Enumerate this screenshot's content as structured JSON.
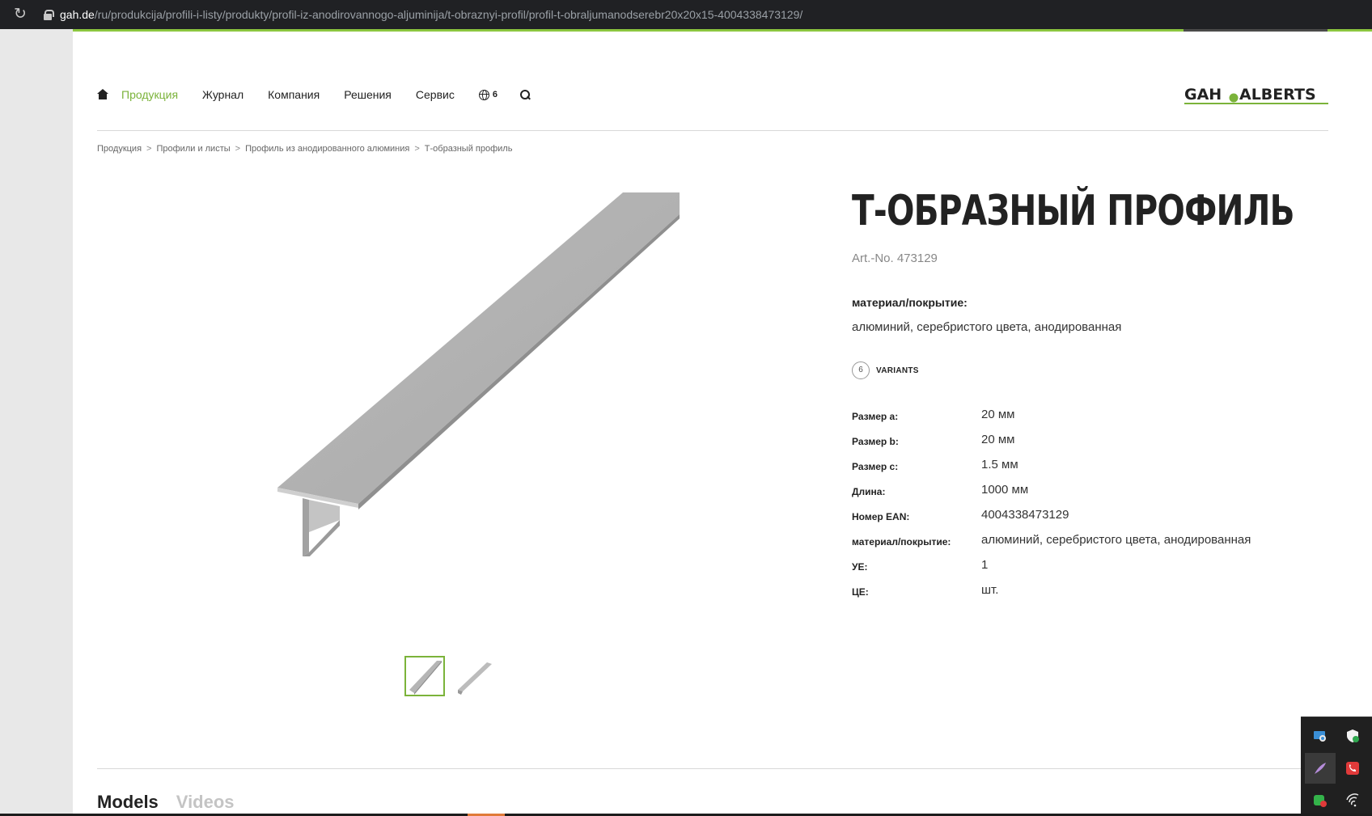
{
  "browser": {
    "url_domain": "gah.de",
    "url_path": "/ru/produkcija/profili-i-listy/produkty/profil-iz-anodirovannogo-aljuminija/t-obraznyi-profil/profil-t-obraljumanodserebr20x20x15-4004338473129/"
  },
  "nav": {
    "items": [
      {
        "label": "Продукция",
        "active": true
      },
      {
        "label": "Журнал",
        "active": false
      },
      {
        "label": "Компания",
        "active": false
      },
      {
        "label": "Решения",
        "active": false
      },
      {
        "label": "Сервис",
        "active": false
      }
    ],
    "language_count": "6",
    "logo": "GAH ALBERTS"
  },
  "breadcrumb": [
    "Продукция",
    "Профили и листы",
    "Профиль из анодированного алюминия",
    "Т-образный профиль"
  ],
  "product": {
    "title": "Т-ОБРАЗНЫЙ ПРОФИЛЬ",
    "artno": "Art.-No. 473129",
    "material_label": "материал/покрытие:",
    "material_value": "алюминий, серебристого цвета, анодированная",
    "variants_count": "6",
    "variants_label": "VARIANTS",
    "specs": [
      {
        "key": "Размер а:",
        "value": "20 мм"
      },
      {
        "key": "Размер b:",
        "value": "20 мм"
      },
      {
        "key": "Размер c:",
        "value": "1.5 мм"
      },
      {
        "key": "Длина:",
        "value": "1000 мм"
      },
      {
        "key": "Номер EAN:",
        "value": "4004338473129"
      },
      {
        "key": "материал/покрытие:",
        "value": "алюминий, серебристого цвета, анодированная"
      },
      {
        "key": "УЕ:",
        "value": "1"
      },
      {
        "key": "ЦЕ:",
        "value": "шт."
      }
    ]
  },
  "tabs": [
    {
      "label": "Models",
      "active": true
    },
    {
      "label": "Videos",
      "active": false
    }
  ],
  "colors": {
    "accent": "#7bb33a",
    "text": "#222222",
    "muted": "#888888"
  }
}
